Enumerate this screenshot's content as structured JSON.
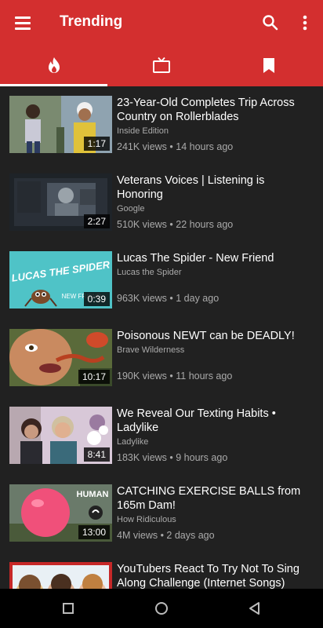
{
  "app": {
    "title": "Trending",
    "accent": "#d32f2f"
  },
  "tabs": [
    {
      "icon": "flame-icon",
      "selected": true
    },
    {
      "icon": "tv-icon",
      "selected": false
    },
    {
      "icon": "bookmark-icon",
      "selected": false
    }
  ],
  "videos": [
    {
      "title": "23-Year-Old Completes Trip Across Country on Rollerblades",
      "channel": "Inside Edition",
      "stats": "241K views • 14 hours ago",
      "duration": "1:17"
    },
    {
      "title": "Veterans Voices | Listening is Honoring",
      "channel": "Google",
      "stats": "510K views • 22 hours ago",
      "duration": "2:27"
    },
    {
      "title": "Lucas The Spider - New Friend",
      "channel": "Lucas the Spider",
      "stats": "963K views • 1 day ago",
      "duration": "0:39",
      "thumb_text": "LUCAS THE SPIDER",
      "thumb_subtext": "NEW FRIEND"
    },
    {
      "title": "Poisonous NEWT can be DEADLY!",
      "channel": "Brave Wilderness",
      "stats": "190K views • 11 hours ago",
      "duration": "10:17"
    },
    {
      "title": "We Reveal Our Texting Habits • Ladylike",
      "channel": "Ladylike",
      "stats": "183K views • 9 hours ago",
      "duration": "8:41"
    },
    {
      "title": "CATCHING EXERCISE BALLS from 165m Dam!",
      "channel": "How Ridiculous",
      "stats": "4M views • 2 days ago",
      "duration": "13:00",
      "thumb_text": "HUMAN"
    },
    {
      "title": "YouTubers React To Try Not To Sing Along Challenge (Internet Songs)",
      "channel": "",
      "stats": "",
      "duration": ""
    }
  ],
  "navbar": {
    "buttons": [
      "recents-icon",
      "home-icon",
      "back-icon"
    ]
  }
}
